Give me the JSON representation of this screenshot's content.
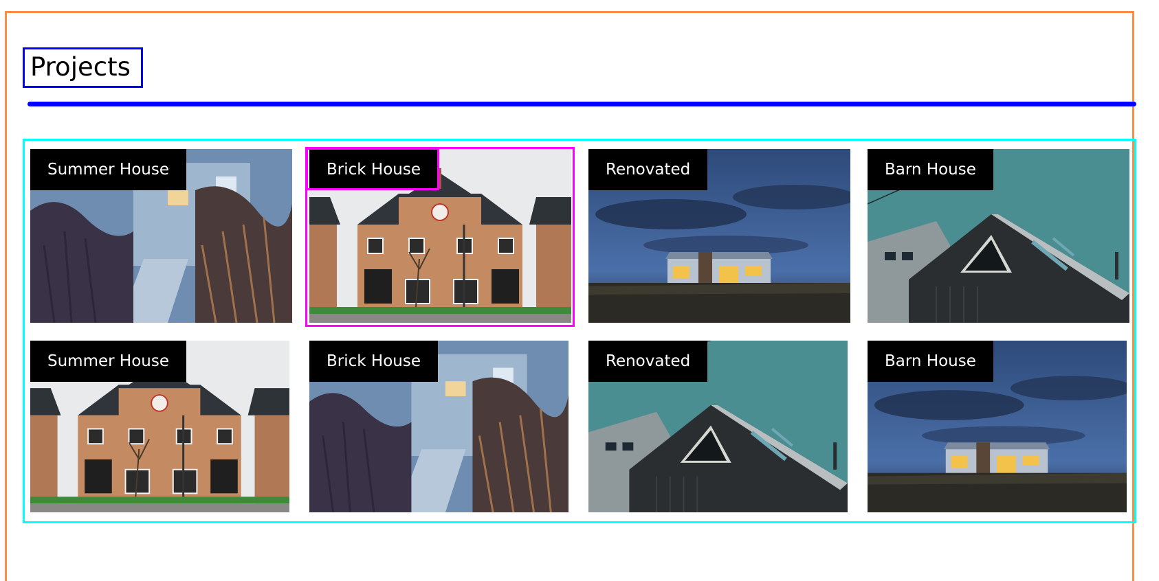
{
  "page": {
    "title": "Projects"
  },
  "colors": {
    "outer_frame": "#ff8c42",
    "title_frame": "#0000ff",
    "divider": "#0000ff",
    "grid_frame": "#00ffff",
    "highlight": "#ff00ff",
    "label_bg": "#000000",
    "label_text": "#ffffff"
  },
  "projects": [
    {
      "label": "Summer House",
      "scene": "boardwalk-house-photo"
    },
    {
      "label": "Brick House",
      "scene": "brick-house-photo"
    },
    {
      "label": "Renovated",
      "scene": "night-bungalow-photo"
    },
    {
      "label": "Barn House",
      "scene": "barn-house-photo"
    },
    {
      "label": "Summer House",
      "scene": "brick-house-photo"
    },
    {
      "label": "Brick House",
      "scene": "boardwalk-house-photo"
    },
    {
      "label": "Renovated",
      "scene": "barn-house-photo"
    },
    {
      "label": "Barn House",
      "scene": "night-bungalow-photo"
    }
  ]
}
